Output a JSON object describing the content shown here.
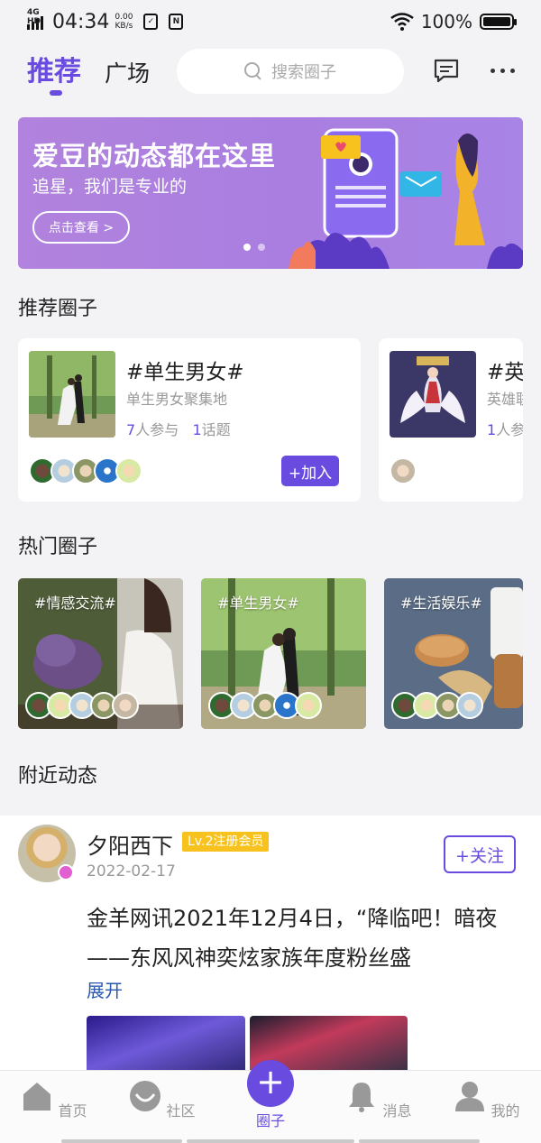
{
  "status_bar": {
    "network": "4G HD",
    "time": "04:34",
    "speed_value": "0.00",
    "speed_unit": "KB/s",
    "battery": "100%",
    "battery_level": 1.0
  },
  "header": {
    "tab_recommend": "推荐",
    "tab_square": "广场",
    "search_placeholder": "搜索圈子"
  },
  "banner": {
    "title": "爱豆的动态都在这里",
    "subtitle": "追星，我们是专业的",
    "button": "点击查看 >",
    "active_dot": 0,
    "dot_count": 2
  },
  "sections": {
    "recommended": "推荐圈子",
    "hot": "热门圈子",
    "nearby": "附近动态"
  },
  "recommended_circles": [
    {
      "name": "#单生男女#",
      "desc": "单生男女聚集地",
      "members_count": "7",
      "members_label": "人参与",
      "topics_count": "1",
      "topics_label": "话题",
      "join": "+加入"
    },
    {
      "name": "#英",
      "desc": "英雄联",
      "members_count": "1",
      "members_label": "人参"
    }
  ],
  "hot_circles": [
    {
      "tag": "#情感交流#"
    },
    {
      "tag": "#单生男女#"
    },
    {
      "tag": "#生活娱乐#"
    }
  ],
  "post": {
    "username": "夕阳西下",
    "level_badge": "Lv.2注册会员",
    "date": "2022-02-17",
    "follow": "+关注",
    "text": "金羊网讯2021年12月4日，“降临吧！暗夜——东风风神奕炫家族年度粉丝盛",
    "expand": "展开"
  },
  "bottom_nav": {
    "home": "首页",
    "community": "社区",
    "circle": "圈子",
    "messages": "消息",
    "mine": "我的"
  },
  "colors": {
    "accent": "#6a4bdf",
    "banner": "#ae82e0",
    "badge": "#f7c21d",
    "link": "#2b59b0"
  }
}
